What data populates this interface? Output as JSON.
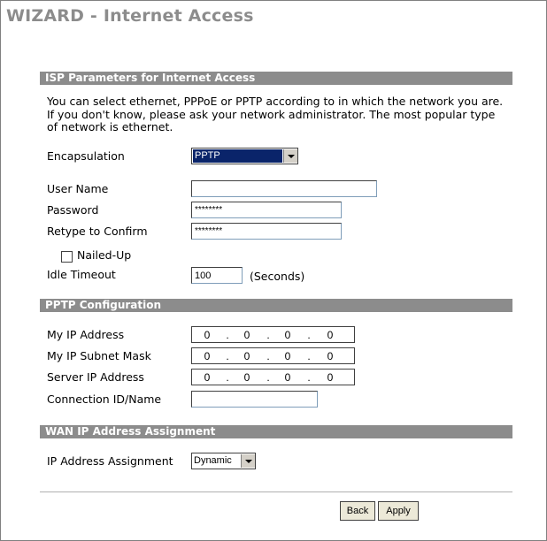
{
  "page_title": "WIZARD - Internet Access",
  "isp_section": {
    "title": "ISP Parameters for Internet Access",
    "description": "You can select ethernet, PPPoE or PPTP according to in which the network you are. If you don't know, please ask your network administrator. The most popular type of network is ethernet.",
    "encapsulation_label": "Encapsulation",
    "encapsulation_value": "PPTP",
    "username_label": "User Name",
    "username_value": "",
    "password_label": "Password",
    "password_value": "********",
    "retype_label": "Retype to Confirm",
    "retype_value": "********",
    "nailed_up_label": "Nailed-Up",
    "nailed_up_checked": false,
    "idle_timeout_label": "Idle Timeout",
    "idle_timeout_value": "100",
    "idle_timeout_unit": "(Seconds)"
  },
  "pptp_section": {
    "title": "PPTP Configuration",
    "my_ip_label": "My IP Address",
    "my_ip": [
      "0",
      "0",
      "0",
      "0"
    ],
    "subnet_label": "My IP Subnet Mask",
    "subnet": [
      "0",
      "0",
      "0",
      "0"
    ],
    "server_ip_label": "Server IP Address",
    "server_ip": [
      "0",
      "0",
      "0",
      "0"
    ],
    "connection_id_label": "Connection ID/Name",
    "connection_id_value": ""
  },
  "wan_section": {
    "title": "WAN IP Address Assignment",
    "assignment_label": "IP Address Assignment",
    "assignment_value": "Dynamic"
  },
  "buttons": {
    "back": "Back",
    "apply": "Apply"
  },
  "colors": {
    "section_bar": "#8c8c8c",
    "title": "#8c8c8c",
    "select_highlight": "#0a246a"
  }
}
